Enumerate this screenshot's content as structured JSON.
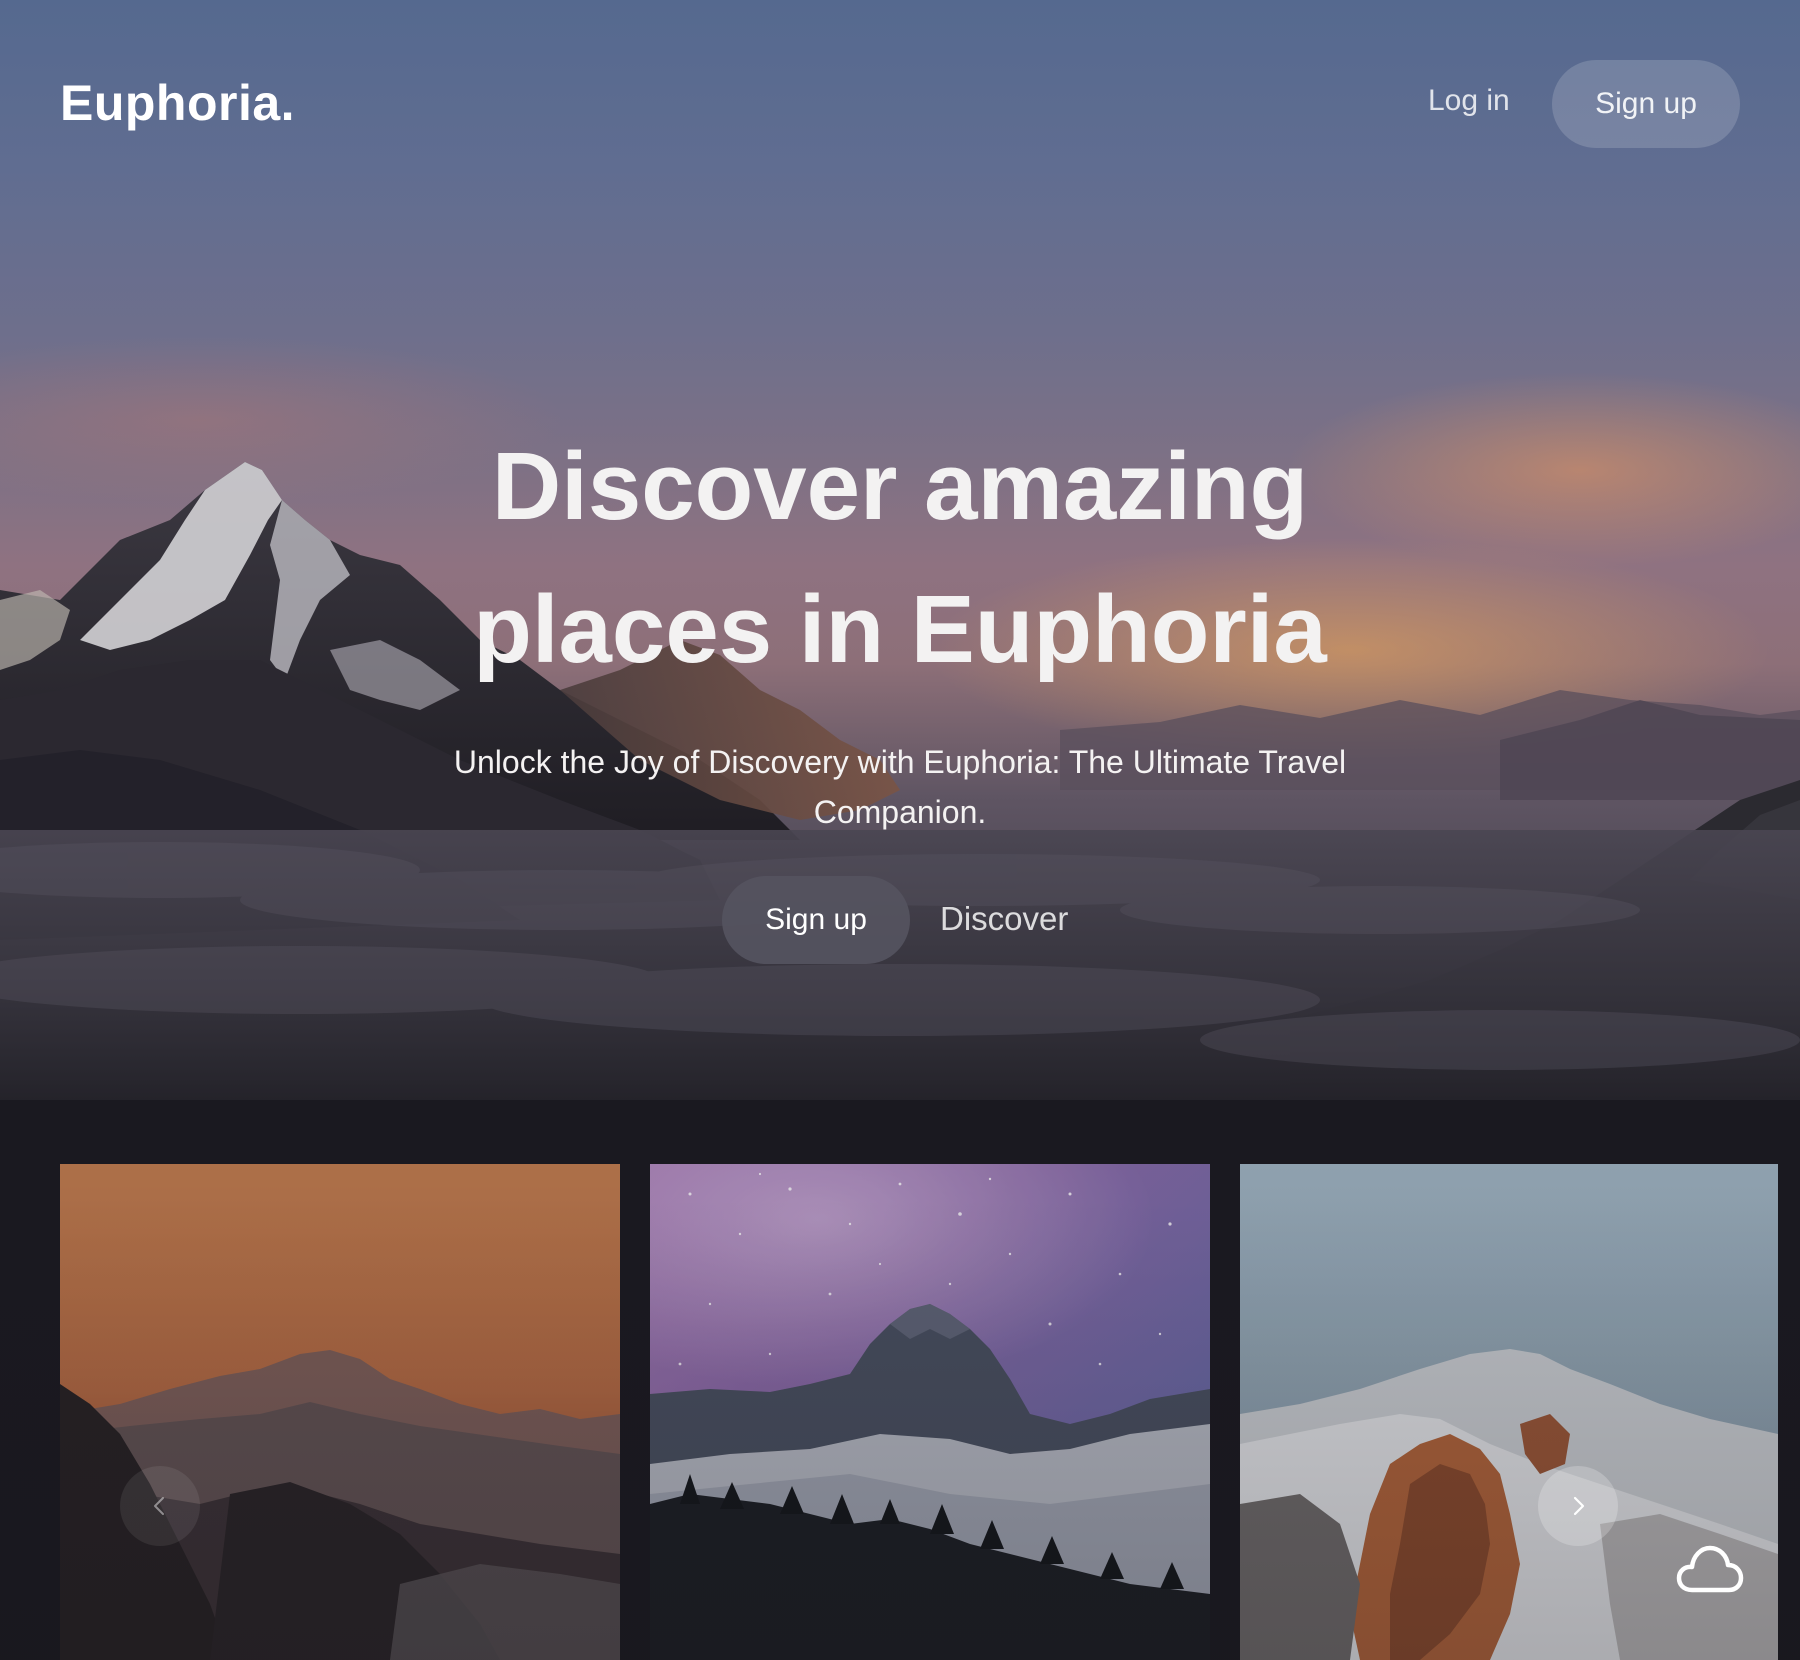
{
  "nav": {
    "logo": "Euphoria.",
    "login_label": "Log in",
    "signup_label": "Sign up"
  },
  "hero": {
    "headline_line1": "Discover amazing",
    "headline_line2": "places in Euphoria",
    "subtitle": "Unlock the Joy of Discovery with Euphoria: The Ultimate Travel Companion.",
    "signup_label": "Sign up",
    "discover_label": "Discover"
  },
  "carousel": {
    "cards": [
      {
        "scene": "sunset-mountains"
      },
      {
        "scene": "starry-night-mountain"
      },
      {
        "scene": "snowy-peak"
      }
    ],
    "prev_icon": "chevron-left-icon",
    "next_icon": "chevron-right-icon"
  },
  "floating_action": {
    "icon": "cloud-icon"
  },
  "colors": {
    "accent_pill": "#555460",
    "text": "#ffffff",
    "background_dark": "#17161b"
  }
}
